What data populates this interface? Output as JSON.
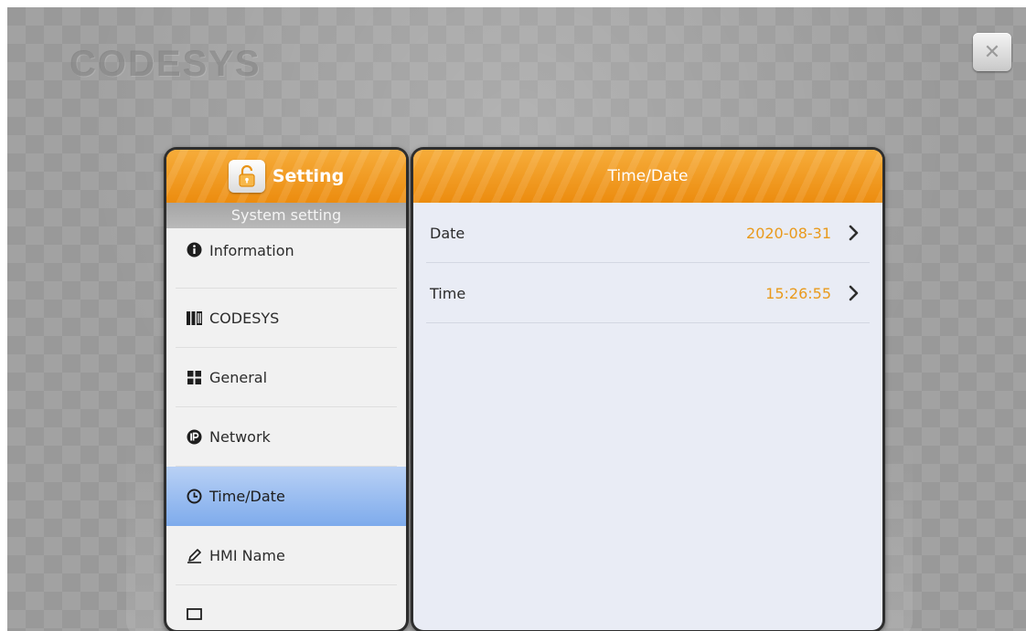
{
  "background": {
    "watermark": "CODESYS"
  },
  "close_button": {
    "symbol": "✕",
    "icon": "close-icon"
  },
  "left_panel": {
    "title": "Setting",
    "lock_icon": "unlock-icon",
    "section_label": "System setting",
    "items": [
      {
        "label": "Information",
        "icon": "info-icon"
      },
      {
        "label": "CODESYS",
        "icon": "codesys-icon"
      },
      {
        "label": "General",
        "icon": "grid-icon"
      },
      {
        "label": "Network",
        "icon": "ip-icon"
      },
      {
        "label": "Time/Date",
        "icon": "clock-icon",
        "active": true
      },
      {
        "label": "HMI Name",
        "icon": "pen-icon"
      }
    ]
  },
  "right_panel": {
    "title": "Time/Date",
    "rows": [
      {
        "label": "Date",
        "value": "2020-08-31"
      },
      {
        "label": "Time",
        "value": "15:26:55"
      }
    ]
  },
  "colors": {
    "accent_orange": "#f29c1f",
    "value_orange": "#e99a1c",
    "active_blue": "#7eabec"
  }
}
